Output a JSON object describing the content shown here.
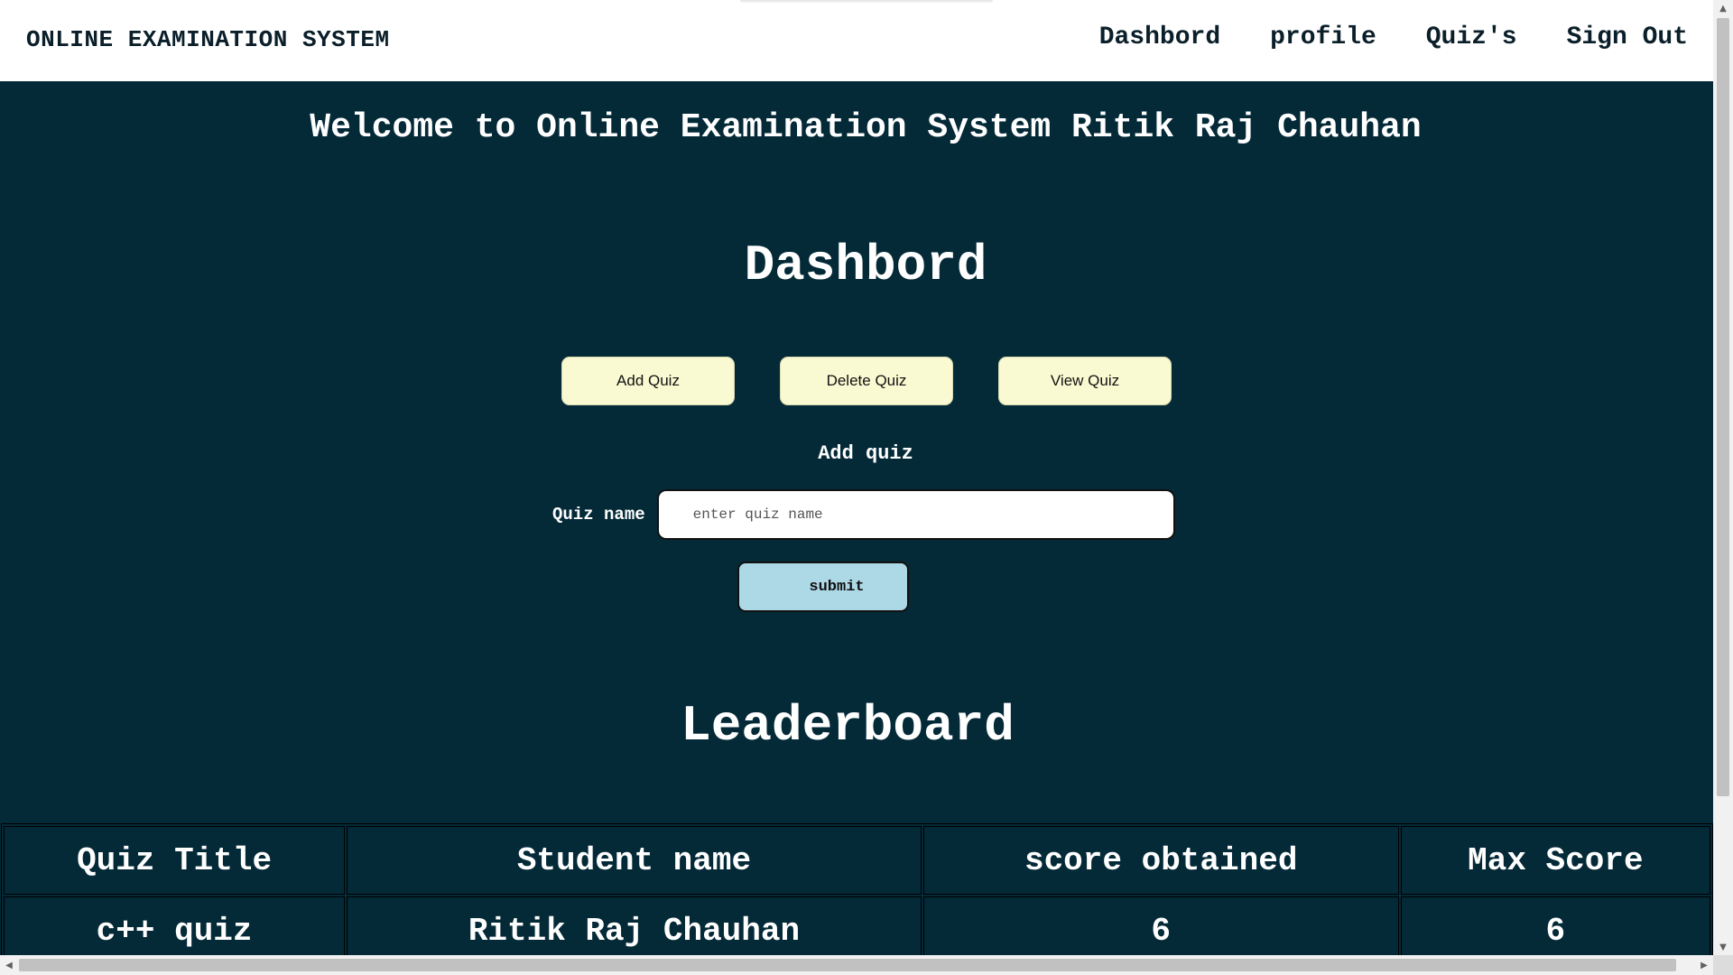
{
  "header": {
    "brand": "ONLINE EXAMINATION SYSTEM",
    "nav": [
      "Dashbord",
      "profile",
      "Quiz's",
      "Sign Out"
    ]
  },
  "welcome": "Welcome to Online Examination System Ritik Raj Chauhan",
  "dashboard": {
    "title": "Dashbord",
    "buttons": [
      "Add Quiz",
      "Delete Quiz",
      "View Quiz"
    ],
    "form_title": "Add quiz",
    "label": "Quiz name",
    "placeholder": "enter quiz name",
    "submit": "submit"
  },
  "leaderboard": {
    "title": "Leaderboard",
    "headers": [
      "Quiz Title",
      "Student name",
      "score obtained",
      "Max Score"
    ],
    "rows": [
      [
        "c++ quiz",
        "Ritik Raj Chauhan",
        "6",
        "6"
      ]
    ]
  },
  "colors": {
    "background": "#042a38",
    "header": "#ffffff",
    "action_button": "#fafad2",
    "submit_button": "#add8e6"
  }
}
